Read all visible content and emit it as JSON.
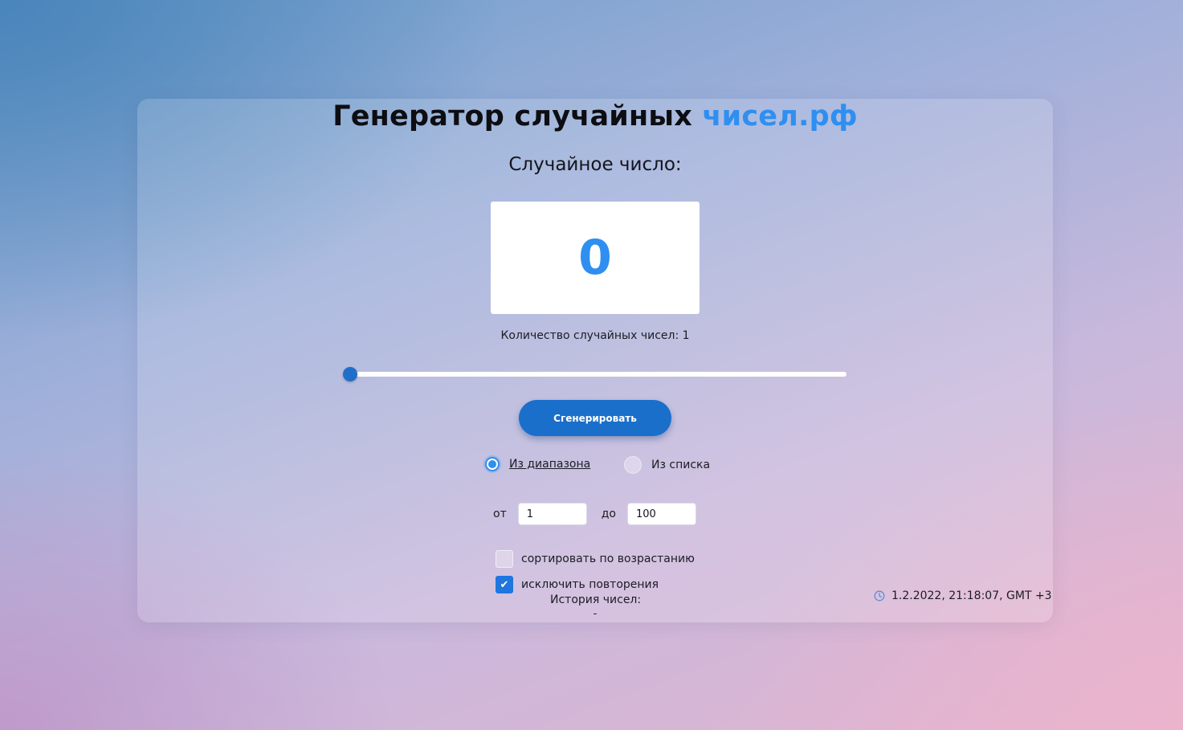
{
  "header": {
    "title_main": "Генератор случайных ",
    "title_accent": "чисел.рф"
  },
  "result": {
    "label": "Случайное число:",
    "value": "0"
  },
  "count": {
    "label": "Количество случайных чисел: 1",
    "slider_value": 1
  },
  "actions": {
    "generate_label": "Сгенерировать"
  },
  "mode": {
    "options": [
      {
        "label": "Из диапазона",
        "checked": true
      },
      {
        "label": "Из списка",
        "checked": false
      }
    ]
  },
  "range": {
    "from_label": "от",
    "from_value": "1",
    "to_label": "до",
    "to_value": "100"
  },
  "options": {
    "sort": {
      "label": "сортировать по возрастанию",
      "checked": false
    },
    "exclude_repeats": {
      "label": "исключить повторения",
      "checked": true
    }
  },
  "history": {
    "title": "История чисел:",
    "value": "-"
  },
  "clock": {
    "datetime": "1.2.2022, 21:18:07, GMT +3",
    "icon": "clock-icon"
  },
  "colors": {
    "accent": "#2f8ff0",
    "button": "#1a6fcb",
    "checkbox": "#1f76de"
  }
}
